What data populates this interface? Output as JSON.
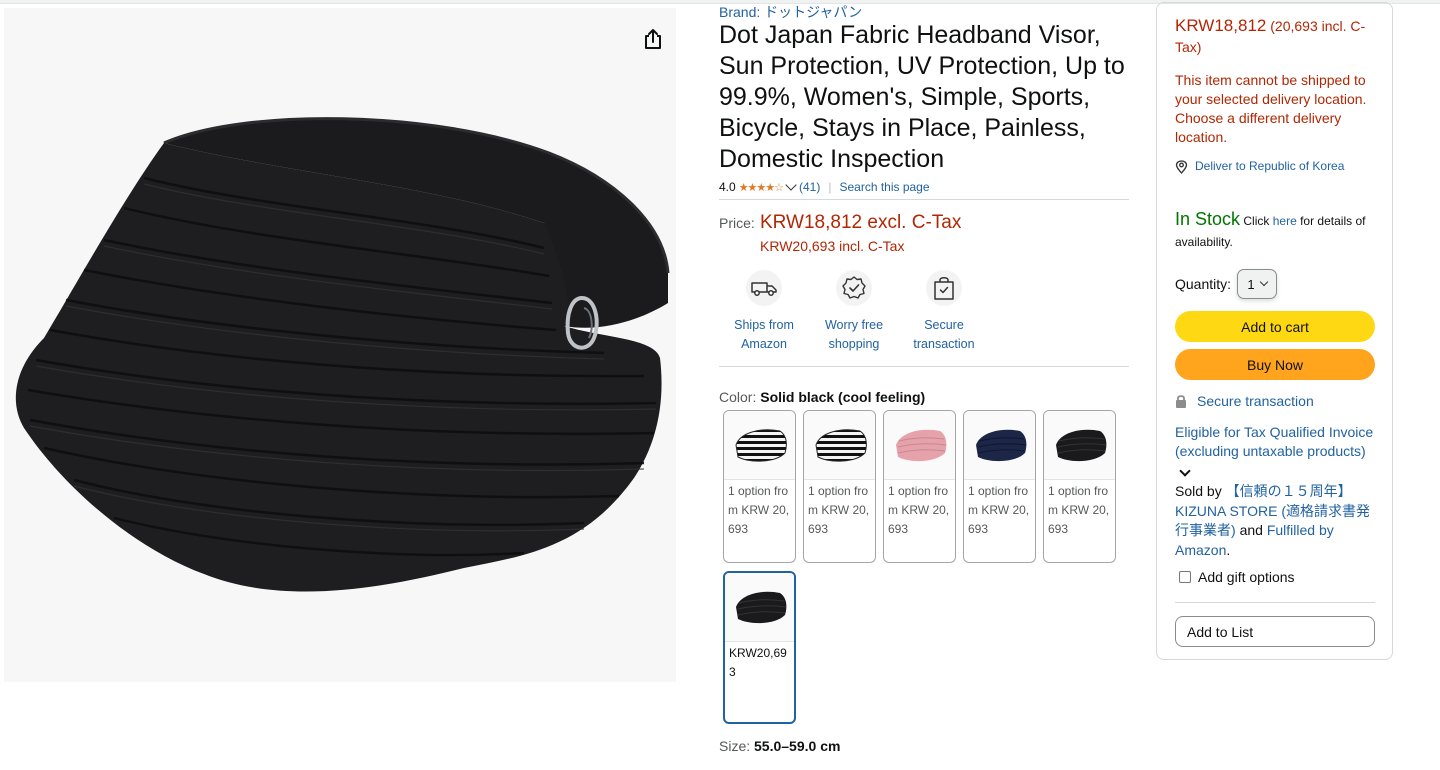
{
  "product": {
    "brand": "Brand: ドットジャパン",
    "title": "Dot Japan Fabric Headband Visor, Sun Protection, UV Protection, Up to 99.9%, Women's, Simple, Sports, Bicycle, Stays in Place, Painless, Domestic Inspection",
    "rating_value": "4.0",
    "stars": "★★★★☆",
    "rating_count": "(41)",
    "search_page": "Search this page"
  },
  "price": {
    "label": "Price:",
    "main": "KRW18,812 excl. C-Tax",
    "incl": "KRW20,693 incl. C-Tax"
  },
  "badges": [
    {
      "label": "Ships from Amazon",
      "icon": "truck-icon"
    },
    {
      "label": "Worry free shopping",
      "icon": "badge-check-icon"
    },
    {
      "label": "Secure transaction",
      "icon": "secure-bag-icon"
    }
  ],
  "color": {
    "label": "Color:",
    "selected": "Solid black (cool feeling)"
  },
  "swatches": [
    {
      "text": "1 option from KRW 20,693",
      "style": "stripe"
    },
    {
      "text": "1 option from KRW 20,693",
      "style": "stripe"
    },
    {
      "text": "1 option from KRW 20,693",
      "style": "pink"
    },
    {
      "text": "1 option from KRW 20,693",
      "style": "navy"
    },
    {
      "text": "1 option from KRW 20,693",
      "style": "black"
    },
    {
      "text": "KRW20,693",
      "style": "black",
      "selected": true
    }
  ],
  "size": {
    "label": "Size:",
    "value": "55.0–59.0 cm"
  },
  "buybox": {
    "price": "KRW18,812",
    "price_incl": "(20,693 incl. C-Tax)",
    "warning": "This item cannot be shipped to your selected delivery location. Choose a different delivery location.",
    "deliver": "Deliver to Republic of Korea",
    "in_stock": "In Stock",
    "click": "Click",
    "here": "here",
    "availability": "for details of availability.",
    "quantity_label": "Quantity:",
    "quantity_value": "1",
    "add_to_cart": "Add to cart",
    "buy_now": "Buy Now",
    "secure": "Secure transaction",
    "invoice": "Eligible for Tax Qualified Invoice (excluding untaxable products)",
    "sold_by_prefix": "Sold by",
    "seller": "【信頼の１５周年】KIZUNA STORE (適格請求書発行事業者)",
    "and": "and",
    "fulfilled": "Fulfilled by Amazon",
    "period": ".",
    "gift": "Add gift options",
    "add_to_list": "Add to List"
  },
  "colors": {
    "price_red": "#b12704",
    "link_blue": "#2162a1",
    "in_stock_green": "#007600",
    "cart_yellow": "#ffd814",
    "buy_orange": "#ffa41c"
  }
}
